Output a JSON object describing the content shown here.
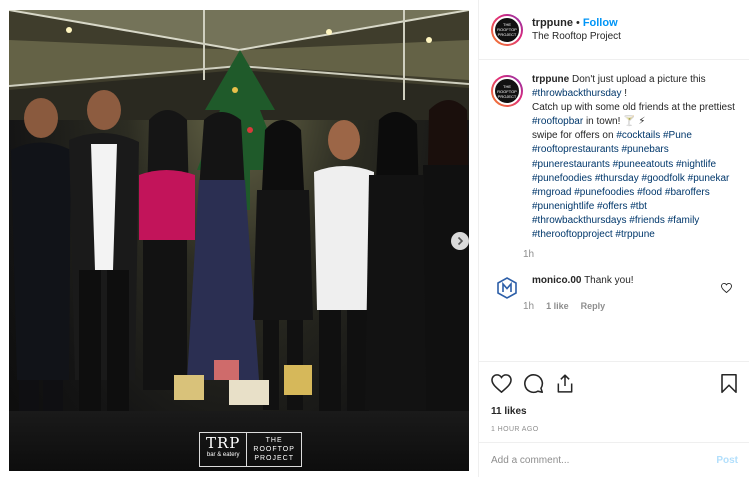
{
  "header": {
    "username": "trppune",
    "separator": "•",
    "follow_label": "Follow",
    "location": "The Rooftop Project"
  },
  "avatar": {
    "line1": "THE",
    "line2": "ROOFTOP",
    "line3": "PROJECT"
  },
  "photo": {
    "logo_trp": "TRP",
    "logo_sub": "bar & eatery",
    "logo_name_1": "THE",
    "logo_name_2": "ROOFTOP",
    "logo_name_3": "PROJECT",
    "next_icon": "chevron-right-icon"
  },
  "caption": {
    "username": "trppune",
    "text_1": "Don't just upload a picture this",
    "tag_1": "#throwbackthursday",
    "text_2": "!",
    "text_3": "Catch up with some old friends at the prettiest",
    "tag_2": "#rooftopbar",
    "text_4": "in town! 🍸 ⚡",
    "text_5": "swipe for offers on",
    "tags": "#cocktails #Pune #rooftoprestaurants #punebars #punerestaurants #puneeatouts #nightlife #punefoodies #thursday #goodfolk #punekar #mgroad #punefoodies #food #baroffers #punenightlife #offers #tbt #throwbackthursdays #friends #family #therooftopproject #trppune",
    "time": "1h"
  },
  "reply": {
    "username": "monico.00",
    "text": "Thank you!",
    "time": "1h",
    "likes": "1 like",
    "reply_label": "Reply"
  },
  "actions": {
    "like_icon": "heart-icon",
    "comment_icon": "comment-icon",
    "share_icon": "share-icon",
    "save_icon": "bookmark-icon",
    "likes_count": "11 likes",
    "time_ago": "1 HOUR AGO"
  },
  "comment_box": {
    "placeholder": "Add a comment...",
    "post_label": "Post"
  },
  "colors": {
    "link_blue": "#0095f6",
    "hashtag": "#00376b",
    "muted": "#8e8e8e",
    "post_disabled": "#b2dffc"
  }
}
